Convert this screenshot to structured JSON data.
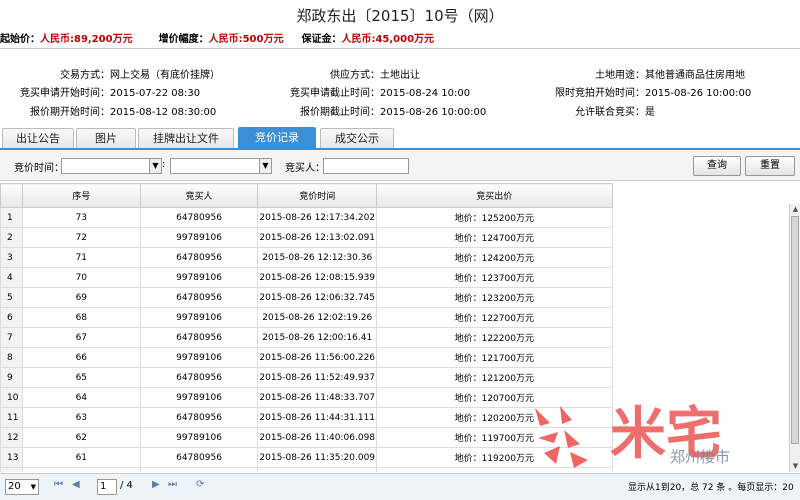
{
  "title": "郑政东出〔2015〕10号（网）",
  "price_line": {
    "start_label": "起始价：",
    "start_value": "人民币:89,200万元",
    "increment_label": "增价幅度：",
    "increment_value": "人民币:500万元",
    "deposit_label": "保证金：",
    "deposit_value": "人民币:45,000万元"
  },
  "info": {
    "trade_method_label": "交易方式：",
    "trade_method_value": "网上交易（有底价挂牌）",
    "supply_method_label": "供应方式：",
    "supply_method_value": "土地出让",
    "land_use_label": "土地用途：",
    "land_use_value": "其他普通商品住房用地",
    "apply_start_label": "竞买申请开始时间：",
    "apply_start_value": "2015-07-22 08:30",
    "apply_end_label": "竞买申请截止时间：",
    "apply_end_value": "2015-08-24 10:00",
    "limit_start_label": "限时竞拍开始时间：",
    "limit_start_value": "2015-08-26 10:00:00",
    "quote_start_label": "报价期开始时间：",
    "quote_start_value": "2015-08-12 08:30:00",
    "quote_end_label": "报价期截止时间：",
    "quote_end_value": "2015-08-26 10:00:00",
    "joint_label": "允许联合竞买：",
    "joint_value": "是"
  },
  "tabs": [
    "出让公告",
    "图片",
    "挂牌出让文件",
    "竞价记录",
    "成交公示"
  ],
  "active_tab": 3,
  "filter": {
    "time_label": "竞价时间：",
    "separator": ":",
    "bidder_label": "竞买人：",
    "query_button": "查询",
    "reset_button": "重置"
  },
  "table": {
    "headers": [
      "序号",
      "竞买人",
      "竞价时间",
      "竞买出价"
    ],
    "rows": [
      [
        "1",
        "73",
        "64780956",
        "2015-08-26 12:17:34.202",
        "地价：125200万元"
      ],
      [
        "2",
        "72",
        "99789106",
        "2015-08-26 12:13:02.091",
        "地价：124700万元"
      ],
      [
        "3",
        "71",
        "64780956",
        "2015-08-26 12:12:30.36",
        "地价：124200万元"
      ],
      [
        "4",
        "70",
        "99789106",
        "2015-08-26 12:08:15.939",
        "地价：123700万元"
      ],
      [
        "5",
        "69",
        "64780956",
        "2015-08-26 12:06:32.745",
        "地价：123200万元"
      ],
      [
        "6",
        "68",
        "99789106",
        "2015-08-26 12:02:19.26",
        "地价：122700万元"
      ],
      [
        "7",
        "67",
        "64780956",
        "2015-08-26 12:00:16.41",
        "地价：122200万元"
      ],
      [
        "8",
        "66",
        "99789106",
        "2015-08-26 11:56:00.226",
        "地价：121700万元"
      ],
      [
        "9",
        "65",
        "64780956",
        "2015-08-26 11:52:49.937",
        "地价：121200万元"
      ],
      [
        "10",
        "64",
        "99789106",
        "2015-08-26 11:48:33.707",
        "地价：120700万元"
      ],
      [
        "11",
        "63",
        "64780956",
        "2015-08-26 11:44:31.111",
        "地价：120200万元"
      ],
      [
        "12",
        "62",
        "99789106",
        "2015-08-26 11:40:06.098",
        "地价：119700万元"
      ],
      [
        "13",
        "61",
        "64780956",
        "2015-08-26 11:35:20.009",
        "地价：119200万元"
      ],
      [
        "14",
        "60",
        "99789106",
        "2015-08-26 11:31:01.079",
        "地价：118700万元"
      ],
      [
        "15",
        "59",
        "64780956",
        "2015-08-26 11:26:15.053",
        "地价：118200万元"
      ]
    ]
  },
  "pager": {
    "page_size": "20",
    "current_page": "1",
    "total_pages": "/ 4",
    "summary": "显示从1到20，总 72 条 。每页显示：20"
  },
  "watermark": {
    "brand": "米宅",
    "sub": "郑州楼市",
    "url": "www.mizhai.com"
  }
}
